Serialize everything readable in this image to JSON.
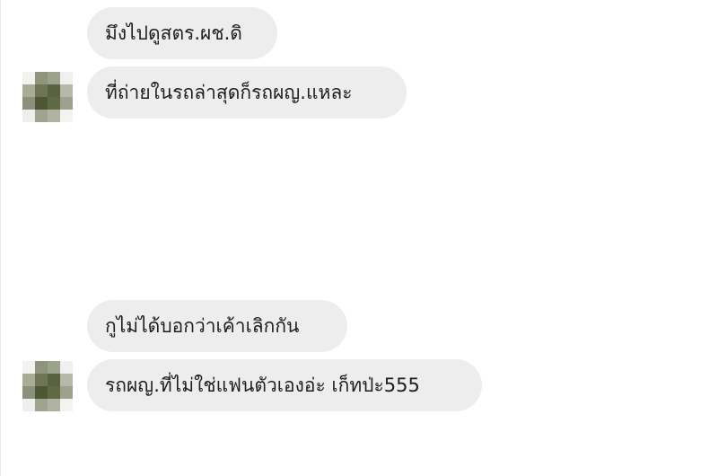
{
  "conversation": {
    "messages": [
      {
        "text": "มึงไปดูสตร.ผช.ดิ"
      },
      {
        "text": "ที่ถ่ายในรถล่าสุดก็รถผญ.แหละ"
      },
      {
        "text": "กูไม่ได้บอกว่าเค้าเลิกกัน"
      },
      {
        "text": "รถผญ.ที่ไม่ใช่แฟนตัวเองอ่ะ เก็ทป่ะ555"
      }
    ]
  },
  "colors": {
    "bubble_background": "#ededed",
    "text": "#1c1e21",
    "page_background": "#ffffff"
  },
  "avatars": [
    {
      "icon": "pixelated-avatar-icon"
    },
    {
      "icon": "pixelated-avatar-icon"
    }
  ]
}
